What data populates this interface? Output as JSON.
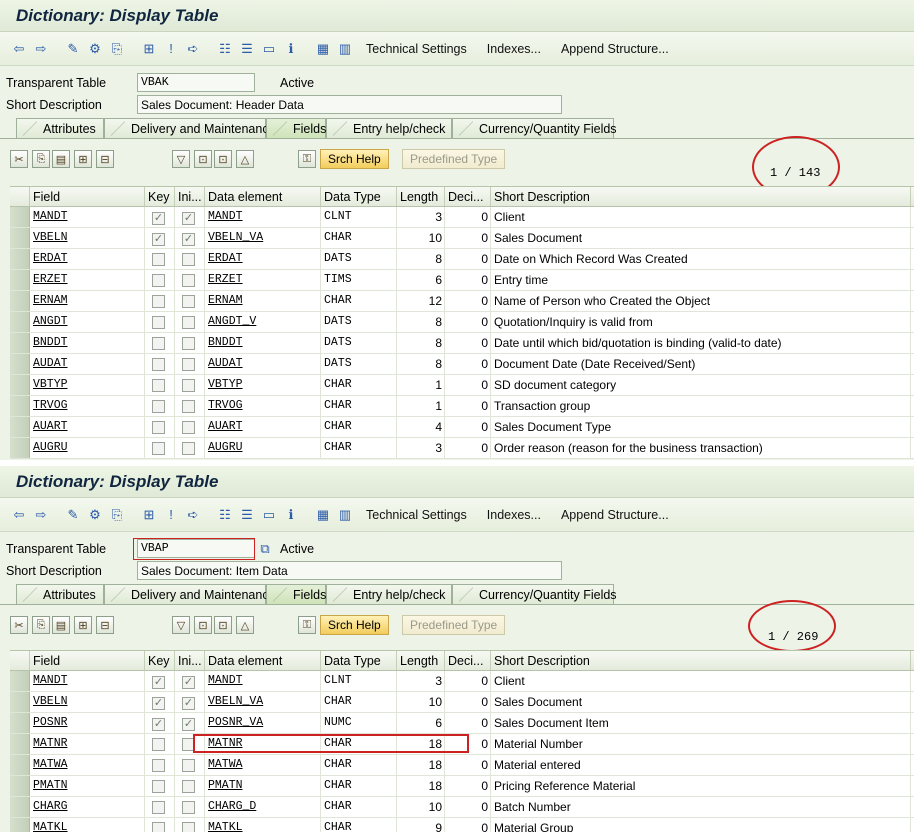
{
  "screens": [
    {
      "title": "Dictionary: Display Table",
      "toolbar": {
        "technical_settings": "Technical Settings",
        "indexes": "Indexes...",
        "append_structure": "Append Structure..."
      },
      "transparent_table_label": "Transparent Table",
      "table_name": "VBAK",
      "status": "Active",
      "short_description_label": "Short Description",
      "short_description": "Sales Document: Header Data",
      "tabs": [
        "Attributes",
        "Delivery and Maintenance",
        "Fields",
        "Entry help/check",
        "Currency/Quantity Fields"
      ],
      "active_tab": "Fields",
      "search_help_button": "Srch Help",
      "predefined_type_button": "Predefined Type",
      "counter": "1  /  143",
      "columns": [
        "Field",
        "Key",
        "Ini...",
        "Data element",
        "Data Type",
        "Length",
        "Deci...",
        "Short Description"
      ],
      "rows": [
        {
          "field": "MANDT",
          "key": true,
          "ini": true,
          "element": "MANDT",
          "type": "CLNT",
          "length": "3",
          "dec": "0",
          "desc": "Client"
        },
        {
          "field": "VBELN",
          "key": true,
          "ini": true,
          "element": "VBELN_VA",
          "type": "CHAR",
          "length": "10",
          "dec": "0",
          "desc": "Sales Document"
        },
        {
          "field": "ERDAT",
          "key": false,
          "ini": false,
          "element": "ERDAT",
          "type": "DATS",
          "length": "8",
          "dec": "0",
          "desc": "Date on Which Record Was Created"
        },
        {
          "field": "ERZET",
          "key": false,
          "ini": false,
          "element": "ERZET",
          "type": "TIMS",
          "length": "6",
          "dec": "0",
          "desc": "Entry time"
        },
        {
          "field": "ERNAM",
          "key": false,
          "ini": false,
          "element": "ERNAM",
          "type": "CHAR",
          "length": "12",
          "dec": "0",
          "desc": "Name of Person who Created the Object"
        },
        {
          "field": "ANGDT",
          "key": false,
          "ini": false,
          "element": "ANGDT_V",
          "type": "DATS",
          "length": "8",
          "dec": "0",
          "desc": "Quotation/Inquiry is valid from"
        },
        {
          "field": "BNDDT",
          "key": false,
          "ini": false,
          "element": "BNDDT",
          "type": "DATS",
          "length": "8",
          "dec": "0",
          "desc": "Date until which bid/quotation is binding (valid-to date)"
        },
        {
          "field": "AUDAT",
          "key": false,
          "ini": false,
          "element": "AUDAT",
          "type": "DATS",
          "length": "8",
          "dec": "0",
          "desc": "Document Date (Date Received/Sent)"
        },
        {
          "field": "VBTYP",
          "key": false,
          "ini": false,
          "element": "VBTYP",
          "type": "CHAR",
          "length": "1",
          "dec": "0",
          "desc": "SD document category"
        },
        {
          "field": "TRVOG",
          "key": false,
          "ini": false,
          "element": "TRVOG",
          "type": "CHAR",
          "length": "1",
          "dec": "0",
          "desc": "Transaction group"
        },
        {
          "field": "AUART",
          "key": false,
          "ini": false,
          "element": "AUART",
          "type": "CHAR",
          "length": "4",
          "dec": "0",
          "desc": "Sales Document Type"
        },
        {
          "field": "AUGRU",
          "key": false,
          "ini": false,
          "element": "AUGRU",
          "type": "CHAR",
          "length": "3",
          "dec": "0",
          "desc": "Order reason (reason for the business transaction)"
        }
      ]
    },
    {
      "title": "Dictionary: Display Table",
      "toolbar": {
        "technical_settings": "Technical Settings",
        "indexes": "Indexes...",
        "append_structure": "Append Structure..."
      },
      "transparent_table_label": "Transparent Table",
      "table_name": "VBAP",
      "status": "Active",
      "short_description_label": "Short Description",
      "short_description": "Sales Document: Item Data",
      "tabs": [
        "Attributes",
        "Delivery and Maintenance",
        "Fields",
        "Entry help/check",
        "Currency/Quantity Fields"
      ],
      "active_tab": "Fields",
      "search_help_button": "Srch Help",
      "predefined_type_button": "Predefined Type",
      "counter": "1  /  269",
      "columns": [
        "Field",
        "Key",
        "Ini...",
        "Data element",
        "Data Type",
        "Length",
        "Deci...",
        "Short Description"
      ],
      "rows": [
        {
          "field": "MANDT",
          "key": true,
          "ini": true,
          "element": "MANDT",
          "type": "CLNT",
          "length": "3",
          "dec": "0",
          "desc": "Client"
        },
        {
          "field": "VBELN",
          "key": true,
          "ini": true,
          "element": "VBELN_VA",
          "type": "CHAR",
          "length": "10",
          "dec": "0",
          "desc": "Sales Document"
        },
        {
          "field": "POSNR",
          "key": true,
          "ini": true,
          "element": "POSNR_VA",
          "type": "NUMC",
          "length": "6",
          "dec": "0",
          "desc": "Sales Document Item"
        },
        {
          "field": "MATNR",
          "key": false,
          "ini": false,
          "element": "MATNR",
          "type": "CHAR",
          "length": "18",
          "dec": "0",
          "desc": "Material Number"
        },
        {
          "field": "MATWA",
          "key": false,
          "ini": false,
          "element": "MATWA",
          "type": "CHAR",
          "length": "18",
          "dec": "0",
          "desc": "Material entered"
        },
        {
          "field": "PMATN",
          "key": false,
          "ini": false,
          "element": "PMATN",
          "type": "CHAR",
          "length": "18",
          "dec": "0",
          "desc": "Pricing Reference Material"
        },
        {
          "field": "CHARG",
          "key": false,
          "ini": false,
          "element": "CHARG_D",
          "type": "CHAR",
          "length": "10",
          "dec": "0",
          "desc": "Batch Number"
        },
        {
          "field": "MATKL",
          "key": false,
          "ini": false,
          "element": "MATKL",
          "type": "CHAR",
          "length": "9",
          "dec": "0",
          "desc": "Material Group"
        }
      ]
    }
  ],
  "highlight_color": "#cc2222",
  "icons": [
    "back-icon",
    "forward-icon",
    "other-object-icon",
    "activate-icon",
    "where-used-icon",
    "object-list-icon",
    "hierarchy-icon",
    "info-icon",
    "display-object-list-icon",
    "help-icon",
    "check-icon",
    "technical-settings-icon",
    "indexes-icon",
    "cut-icon",
    "copy-icon",
    "paste-icon",
    "insert-row-icon",
    "delete-row-icon",
    "first-page-icon",
    "prev-page-icon",
    "next-page-icon",
    "last-page-icon",
    "key-icon"
  ]
}
